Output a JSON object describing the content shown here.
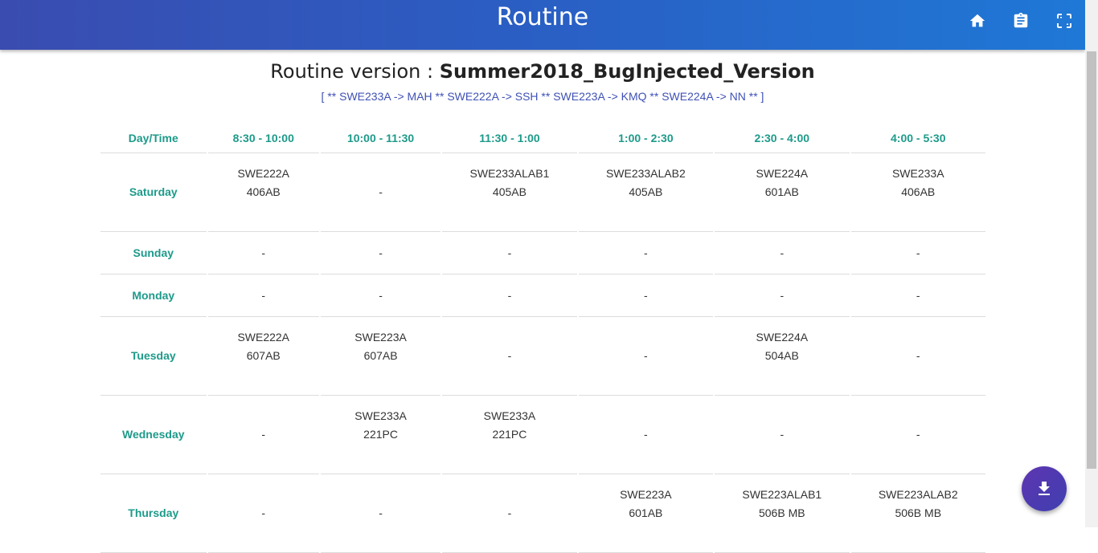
{
  "appbar": {
    "title": "Routine",
    "icons": [
      "home-icon",
      "clipboard-icon",
      "fullscreen-icon"
    ]
  },
  "version": {
    "prefix": "Routine version : ",
    "name": "Summer2018_BugInjected_Version"
  },
  "mapping": "[ ** SWE233A -> MAH ** SWE222A -> SSH ** SWE223A -> KMQ ** SWE224A -> NN ** ]",
  "table": {
    "headers": [
      "Day/Time",
      "8:30 - 10:00",
      "10:00 - 11:30",
      "11:30 - 1:00",
      "1:00 - 2:30",
      "2:30 - 4:00",
      "4:00 - 5:30"
    ],
    "rows": [
      {
        "day": "Saturday",
        "cells": [
          [
            "SWE222A",
            "406AB"
          ],
          [
            "-"
          ],
          [
            "SWE233ALAB1",
            "405AB"
          ],
          [
            "SWE233ALAB2",
            "405AB"
          ],
          [
            "SWE224A",
            "601AB"
          ],
          [
            "SWE233A",
            "406AB"
          ]
        ]
      },
      {
        "day": "Sunday",
        "cells": [
          [
            "-"
          ],
          [
            "-"
          ],
          [
            "-"
          ],
          [
            "-"
          ],
          [
            "-"
          ],
          [
            "-"
          ]
        ]
      },
      {
        "day": "Monday",
        "cells": [
          [
            "-"
          ],
          [
            "-"
          ],
          [
            "-"
          ],
          [
            "-"
          ],
          [
            "-"
          ],
          [
            "-"
          ]
        ]
      },
      {
        "day": "Tuesday",
        "cells": [
          [
            "SWE222A",
            "607AB"
          ],
          [
            "SWE223A",
            "607AB"
          ],
          [
            "-"
          ],
          [
            "-"
          ],
          [
            "SWE224A",
            "504AB"
          ],
          [
            "-"
          ]
        ]
      },
      {
        "day": "Wednesday",
        "cells": [
          [
            "-"
          ],
          [
            "SWE233A",
            "221PC"
          ],
          [
            "SWE233A",
            "221PC"
          ],
          [
            "-"
          ],
          [
            "-"
          ],
          [
            "-"
          ]
        ]
      },
      {
        "day": "Thursday",
        "cells": [
          [
            "-"
          ],
          [
            "-"
          ],
          [
            "-"
          ],
          [
            "SWE223A",
            "601AB"
          ],
          [
            "SWE223ALAB1",
            "506B MB"
          ],
          [
            "SWE223ALAB2",
            "506B MB"
          ]
        ]
      }
    ]
  },
  "fab": {
    "icon": "download-icon"
  },
  "colors": {
    "appbar_start": "#3a4cb0",
    "appbar_end": "#1f78d6",
    "accent_teal": "#1d9a8a",
    "link_blue": "#3f51b5",
    "fab": "#5e35b1"
  }
}
